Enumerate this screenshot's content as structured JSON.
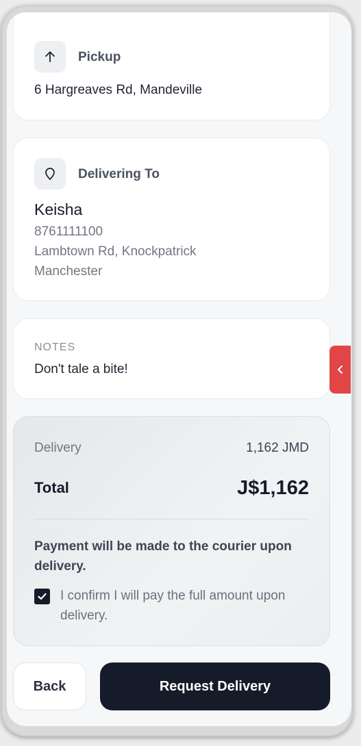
{
  "pickup": {
    "heading": "Pickup",
    "address": "6 Hargreaves Rd, Mandeville",
    "icon": "arrow-up-icon"
  },
  "delivering_to": {
    "heading": "Delivering To",
    "name": "Keisha",
    "phone": "8761111100",
    "address_line1": "Lambtown Rd, Knockpatrick",
    "address_line2": "Manchester",
    "icon": "location-pin-icon"
  },
  "notes": {
    "label": "NOTES",
    "text": "Don't tale a bite!"
  },
  "summary": {
    "delivery_label": "Delivery",
    "delivery_value": "1,162 JMD",
    "total_label": "Total",
    "total_value": "J$1,162",
    "payment_note": "Payment will be made to the courier upon delivery.",
    "confirm_text": "I confirm I will pay the full amount upon delivery.",
    "confirm_checked": true
  },
  "side_tab": {
    "icon": "chevron-left-icon",
    "color": "#e24545"
  },
  "actions": {
    "back_label": "Back",
    "request_label": "Request Delivery"
  },
  "colors": {
    "primary": "#151b28",
    "accent": "#e24545"
  }
}
